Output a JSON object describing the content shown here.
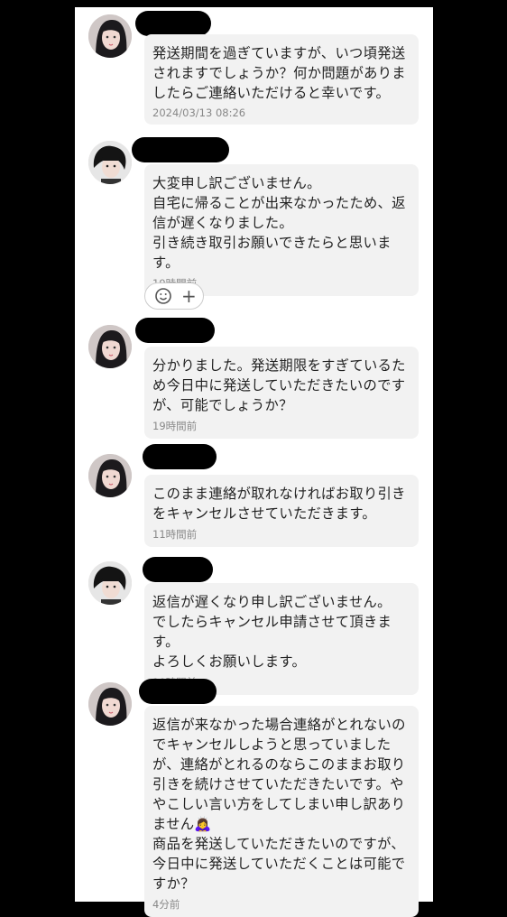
{
  "messages": [
    {
      "text": "発送期間を過ぎていますが、いつ頃発送されますでしょうか？何か問題がありましたらご連絡いただけると幸いです。",
      "time": "2024/03/13 08:26"
    },
    {
      "text": "大変申し訳ございません。\n自宅に帰ることが出来なかったため、返信が遅くなりました。\n引き続き取引お願いできたらと思います。",
      "time": "19時間前"
    },
    {
      "text": "分かりました。発送期限をすぎているため今日中に発送していただきたいのですが、可能でしょうか？",
      "time": "19時間前"
    },
    {
      "text": "このまま連絡が取れなければお取り引きをキャンセルさせていただきます。",
      "time": "11時間前"
    },
    {
      "text": "返信が遅くなり申し訳ございません。\nでしたらキャンセル申請させて頂きます。\nよろしくお願いします。",
      "time": "10時間前"
    },
    {
      "text": "返信が来なかった場合連絡がとれないのでキャンセルしようと思っていましたが、連絡がとれるのならこのままお取り引きを続けさせていただきたいです。ややこしい言い方をしてしまい申し訳ありません🙇‍♀️\n商品を発送していただきたいのですが、今日中に発送していただくことは可能ですか？",
      "time": "4分前"
    }
  ],
  "reaction": {
    "add_label": "+",
    "emoji_icon": "smile-icon"
  },
  "colors": {
    "bubble": "#f2f2f2",
    "timestamp": "#888888",
    "background": "#000000"
  }
}
